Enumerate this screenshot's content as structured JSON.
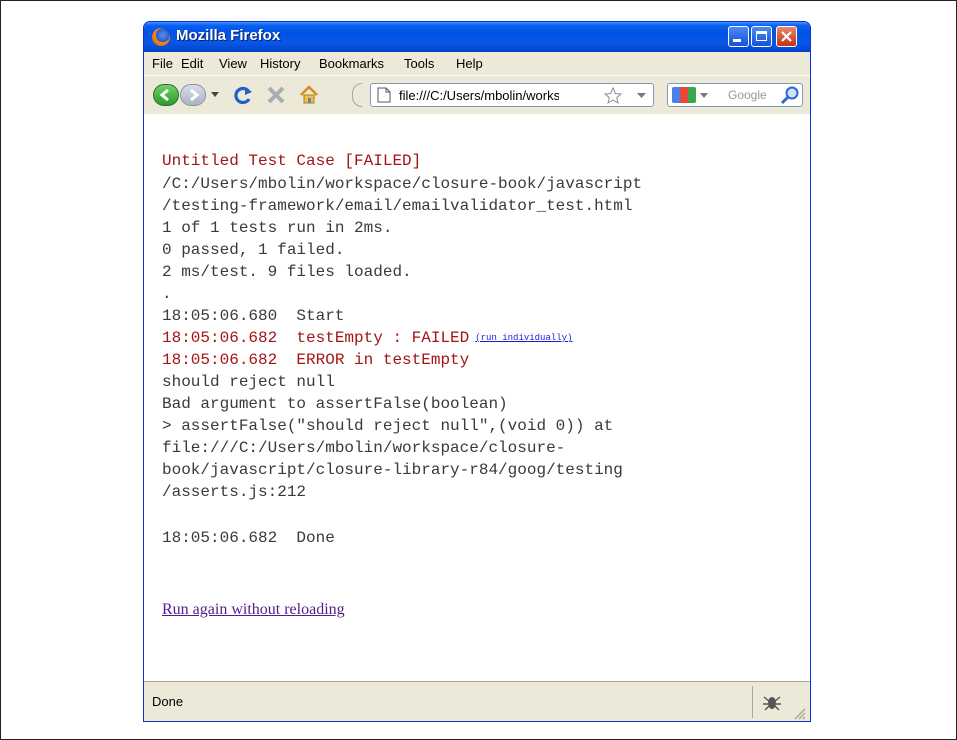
{
  "window": {
    "title": "Mozilla Firefox"
  },
  "menu": [
    "File",
    "Edit",
    "View",
    "History",
    "Bookmarks",
    "Tools",
    "Help"
  ],
  "navbar": {
    "url": "file:///C:/Users/mbolin/workspace/closure-book/javascript/testing-framework/email/emailvalidator_test.html",
    "search_placeholder": "Google"
  },
  "content": {
    "header": "Untitled Test Case [FAILED]",
    "path1": "/C:/Users/mbolin/workspace/closure-book/javascript",
    "path2": "/testing-framework/email/emailvalidator_test.html",
    "tests_run": "1 of 1 tests run in 2ms.",
    "summary": "0 passed, 1 failed.",
    "files": "2 ms/test. 9 files loaded.",
    "dot": ".",
    "start": "18:05:06.680  Start",
    "fail": "18:05:06.682  testEmpty : FAILED",
    "run_individually": "(run individually)",
    "error": "18:05:06.682  ERROR in testEmpty",
    "msg1": "should reject null",
    "msg2": "Bad argument to assertFalse(boolean)",
    "msg3": "> assertFalse(\"should reject null\",(void 0)) at",
    "msg4": "file:///C:/Users/mbolin/workspace/closure-",
    "msg5": "book/javascript/closure-library-r84/goog/testing",
    "msg6": "/asserts.js:212",
    "done": "18:05:06.682  Done",
    "rerun_link": "Run again without reloading"
  },
  "status": {
    "text": "Done"
  },
  "colors": {
    "failed": "#a31515",
    "link": "#1a1adb",
    "visited": "#551a8b",
    "titlebar": "#0054e3"
  }
}
